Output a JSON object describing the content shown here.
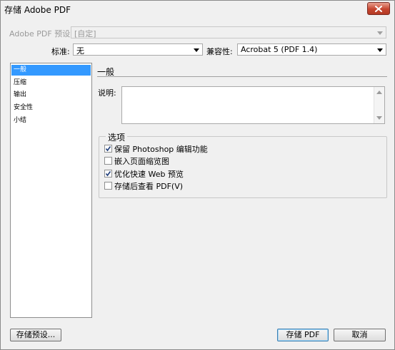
{
  "window": {
    "title": "存储 Adobe PDF"
  },
  "preset": {
    "label": "Adobe PDF 预设:",
    "value": "[自定]"
  },
  "standard": {
    "label": "标准:",
    "value": "无"
  },
  "compat": {
    "label": "兼容性:",
    "value": "Acrobat 5 (PDF 1.4)"
  },
  "sidebar": {
    "items": [
      {
        "label": "一般",
        "selected": true
      },
      {
        "label": "压缩",
        "selected": false
      },
      {
        "label": "输出",
        "selected": false
      },
      {
        "label": "安全性",
        "selected": false
      },
      {
        "label": "小结",
        "selected": false
      }
    ]
  },
  "panel": {
    "heading": "一般",
    "description_label": "说明:",
    "description_value": "",
    "options_title": "选项",
    "options": [
      {
        "label": "保留 Photoshop 编辑功能",
        "checked": true
      },
      {
        "label": "嵌入页面缩览图",
        "checked": false
      },
      {
        "label": "优化快速 Web 预览",
        "checked": true
      },
      {
        "label": "存储后查看 PDF(V)",
        "checked": false
      }
    ]
  },
  "buttons": {
    "save_preset": "存储预设...",
    "save_pdf": "存储 PDF",
    "cancel": "取消"
  },
  "colors": {
    "selection": "#3399ff",
    "close_button": "#c6452f"
  }
}
